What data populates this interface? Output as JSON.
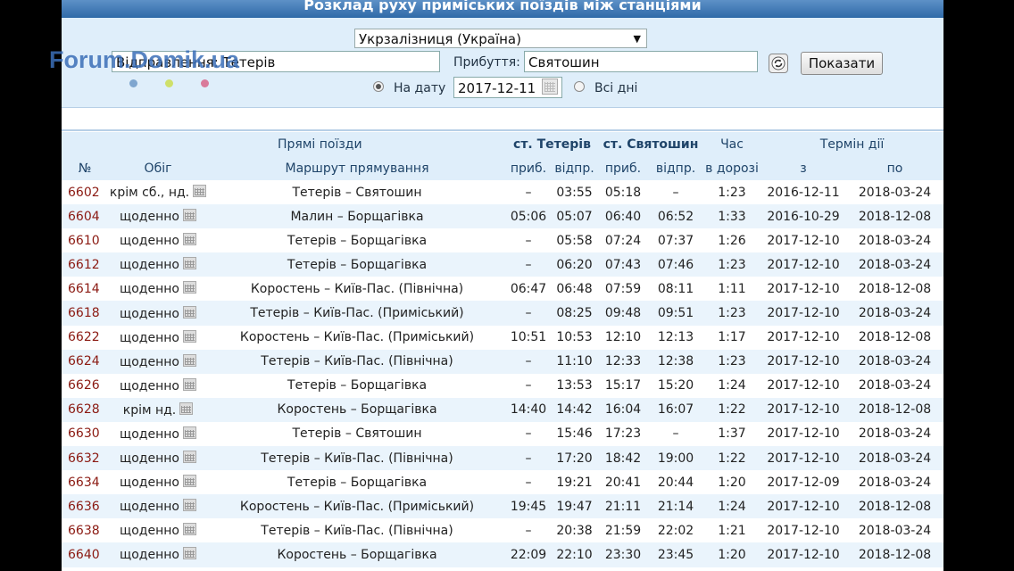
{
  "header": {
    "title": "Розклад руху приміських поїздів між станціями"
  },
  "form": {
    "railway": "Укрзалізниця (Україна)",
    "departure_label": "Відправлення:",
    "departure_value": "Тетерів",
    "arrival_label": "Прибуття:",
    "arrival_value": "Святошин",
    "show_button": "Показати",
    "date_radio_label": "На дату",
    "date_value": "2017-12-11",
    "all_days_label": "Всі дні"
  },
  "watermark": "Forum.Domik.ua",
  "table": {
    "group_headers": {
      "direct": "Прямі поїзди",
      "st_from": "ст. Тетерів",
      "st_to": "ст. Святошин",
      "travel": "Час",
      "validity": "Термін дії"
    },
    "columns": [
      "№",
      "Обіг",
      "Маршрут прямування",
      "приб.",
      "відпр.",
      "приб.",
      "відпр.",
      "в дорозі",
      "з",
      "по"
    ],
    "rows": [
      [
        "6602",
        "крім сб., нд.",
        "Тетерів – Святошин",
        "–",
        "03:55",
        "05:18",
        "–",
        "1:23",
        "2016-12-11",
        "2018-03-24"
      ],
      [
        "6604",
        "щоденно",
        "Малин – Борщагівка",
        "05:06",
        "05:07",
        "06:40",
        "06:52",
        "1:33",
        "2016-10-29",
        "2018-12-08"
      ],
      [
        "6610",
        "щоденно",
        "Тетерів – Борщагівка",
        "–",
        "05:58",
        "07:24",
        "07:37",
        "1:26",
        "2017-12-10",
        "2018-03-24"
      ],
      [
        "6612",
        "щоденно",
        "Тетерів – Борщагівка",
        "–",
        "06:20",
        "07:43",
        "07:46",
        "1:23",
        "2017-12-10",
        "2018-03-24"
      ],
      [
        "6614",
        "щоденно",
        "Коростень – Київ-Пас. (Північна)",
        "06:47",
        "06:48",
        "07:59",
        "08:11",
        "1:11",
        "2017-12-10",
        "2018-12-08"
      ],
      [
        "6618",
        "щоденно",
        "Тетерів – Київ-Пас. (Приміський)",
        "–",
        "08:25",
        "09:48",
        "09:51",
        "1:23",
        "2017-12-10",
        "2018-03-24"
      ],
      [
        "6622",
        "щоденно",
        "Коростень – Київ-Пас. (Приміський)",
        "10:51",
        "10:53",
        "12:10",
        "12:13",
        "1:17",
        "2017-12-10",
        "2018-12-08"
      ],
      [
        "6624",
        "щоденно",
        "Тетерів – Київ-Пас. (Північна)",
        "–",
        "11:10",
        "12:33",
        "12:38",
        "1:23",
        "2017-12-10",
        "2018-03-24"
      ],
      [
        "6626",
        "щоденно",
        "Тетерів – Борщагівка",
        "–",
        "13:53",
        "15:17",
        "15:20",
        "1:24",
        "2017-12-10",
        "2018-03-24"
      ],
      [
        "6628",
        "крім нд.",
        "Коростень – Борщагівка",
        "14:40",
        "14:42",
        "16:04",
        "16:07",
        "1:22",
        "2017-12-10",
        "2018-12-08"
      ],
      [
        "6630",
        "щоденно",
        "Тетерів – Святошин",
        "–",
        "15:46",
        "17:23",
        "–",
        "1:37",
        "2017-12-10",
        "2018-03-24"
      ],
      [
        "6632",
        "щоденно",
        "Тетерів – Київ-Пас. (Північна)",
        "–",
        "17:20",
        "18:42",
        "19:00",
        "1:22",
        "2017-12-10",
        "2018-03-24"
      ],
      [
        "6634",
        "щоденно",
        "Тетерів – Борщагівка",
        "–",
        "19:21",
        "20:41",
        "20:44",
        "1:20",
        "2017-12-09",
        "2018-03-24"
      ],
      [
        "6636",
        "щоденно",
        "Коростень – Київ-Пас. (Приміський)",
        "19:45",
        "19:47",
        "21:11",
        "21:14",
        "1:24",
        "2017-12-10",
        "2018-12-08"
      ],
      [
        "6638",
        "щоденно",
        "Тетерів – Київ-Пас. (Північна)",
        "–",
        "20:38",
        "21:59",
        "22:02",
        "1:21",
        "2017-12-10",
        "2018-03-24"
      ],
      [
        "6640",
        "щоденно",
        "Коростень – Борщагівка",
        "22:09",
        "22:10",
        "23:30",
        "23:45",
        "1:20",
        "2017-12-10",
        "2018-12-08"
      ]
    ]
  },
  "colors": {
    "accent": "#2f6aa8",
    "train_number": "#8b1a12",
    "header_bg": "#dfeefa",
    "row_alt": "#eaf4fc"
  }
}
